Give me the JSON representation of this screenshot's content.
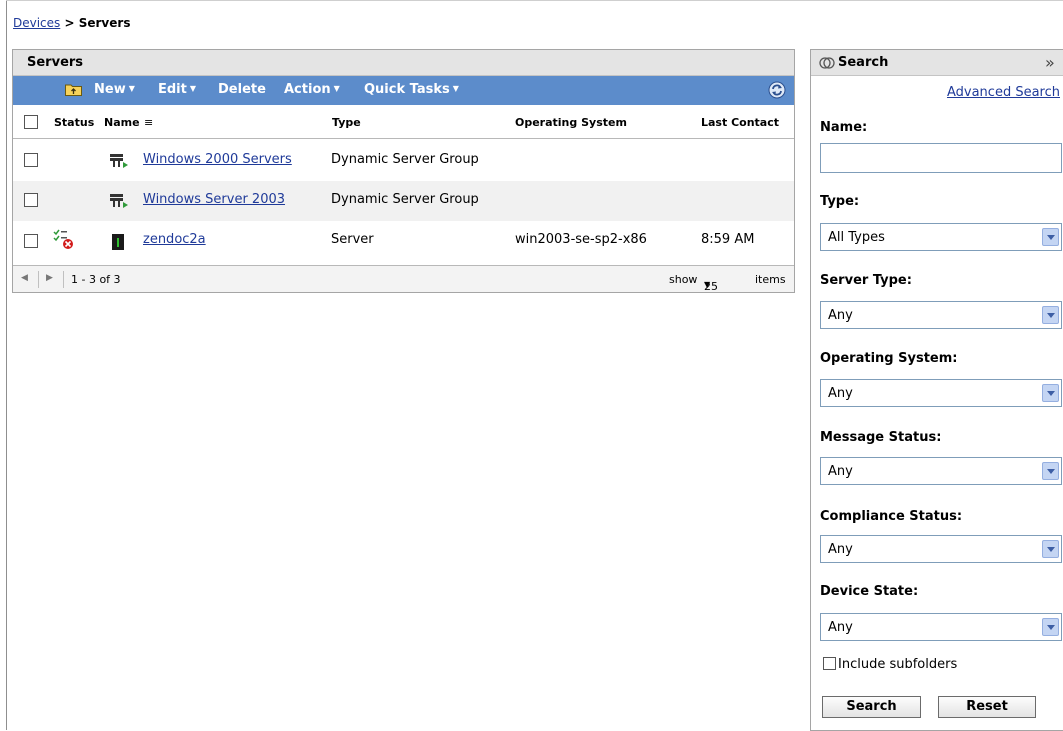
{
  "breadcrumb": {
    "link": "Devices",
    "separator": ">",
    "current": "Servers"
  },
  "servers_panel": {
    "title": "Servers",
    "toolbar": {
      "new": "New",
      "edit": "Edit",
      "delete": "Delete",
      "action": "Action",
      "quick_tasks": "Quick Tasks"
    },
    "columns": {
      "status": "Status",
      "name": "Name",
      "sort_indicator": "≡",
      "type": "Type",
      "os": "Operating System",
      "last_contact": "Last Contact"
    },
    "rows": [
      {
        "name": "Windows 2000 Servers",
        "type": "Dynamic Server Group",
        "os": "",
        "last_contact": "",
        "icon": "dynamic-group-icon"
      },
      {
        "name": "Windows Server 2003",
        "type": "Dynamic Server Group",
        "os": "",
        "last_contact": "",
        "icon": "dynamic-group-icon"
      },
      {
        "name": "zendoc2a",
        "type": "Server",
        "os": "win2003-se-sp2-x86",
        "last_contact": "8:59 AM",
        "icon": "server-icon",
        "status_icon": "compliance-error-icon"
      }
    ],
    "footer": {
      "range": "1 - 3 of 3",
      "show": "show",
      "page_size": "25",
      "items": "items"
    }
  },
  "search_panel": {
    "title": "Search",
    "collapse": "»",
    "advanced_link": "Advanced Search",
    "name_label": "Name:",
    "name_value": "",
    "type_label": "Type:",
    "type_value": "All Types",
    "server_type_label": "Server Type:",
    "server_type_value": "Any",
    "os_label": "Operating System:",
    "os_value": "Any",
    "message_status_label": "Message Status:",
    "message_status_value": "Any",
    "compliance_status_label": "Compliance Status:",
    "compliance_status_value": "Any",
    "device_state_label": "Device State:",
    "device_state_value": "Any",
    "include_subfolders": "Include subfolders",
    "search_button": "Search",
    "reset_button": "Reset"
  },
  "colors": {
    "toolbar_bg": "#5c8ccb",
    "link": "#1f3a99",
    "header_bg": "#e4e4e4"
  }
}
